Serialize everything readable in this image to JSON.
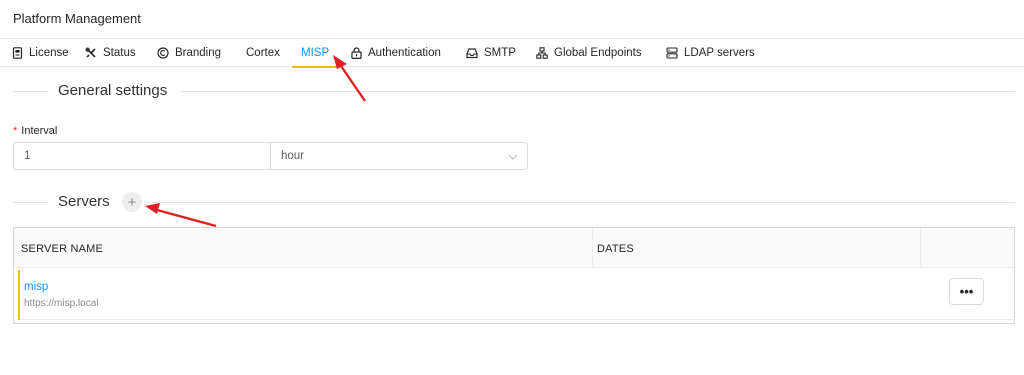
{
  "header": {
    "title": "Platform Management"
  },
  "tabs": [
    {
      "label": "License",
      "icon": "license-icon"
    },
    {
      "label": "Status",
      "icon": "tools-icon"
    },
    {
      "label": "Branding",
      "icon": "copyright-icon"
    },
    {
      "label": "Cortex",
      "icon": ""
    },
    {
      "label": "MISP",
      "icon": ""
    },
    {
      "label": "Authentication",
      "icon": "lock-icon"
    },
    {
      "label": "SMTP",
      "icon": "inbox-icon"
    },
    {
      "label": "Global Endpoints",
      "icon": "cluster-icon"
    },
    {
      "label": "LDAP servers",
      "icon": "database-icon"
    }
  ],
  "active_tab": "MISP",
  "general": {
    "title": "General settings",
    "interval_label": "Interval",
    "interval_value": "1",
    "interval_unit": "hour"
  },
  "servers": {
    "title": "Servers",
    "add_label": "+",
    "columns": [
      "SERVER NAME",
      "DATES"
    ],
    "rows": [
      {
        "name": "misp",
        "url": "https://misp.local",
        "dates": "",
        "actions_label": "•••"
      }
    ]
  },
  "colors": {
    "accent": "#1890ff",
    "tab_underline": "#e6b91e",
    "annotation_arrow": "#e02020"
  }
}
